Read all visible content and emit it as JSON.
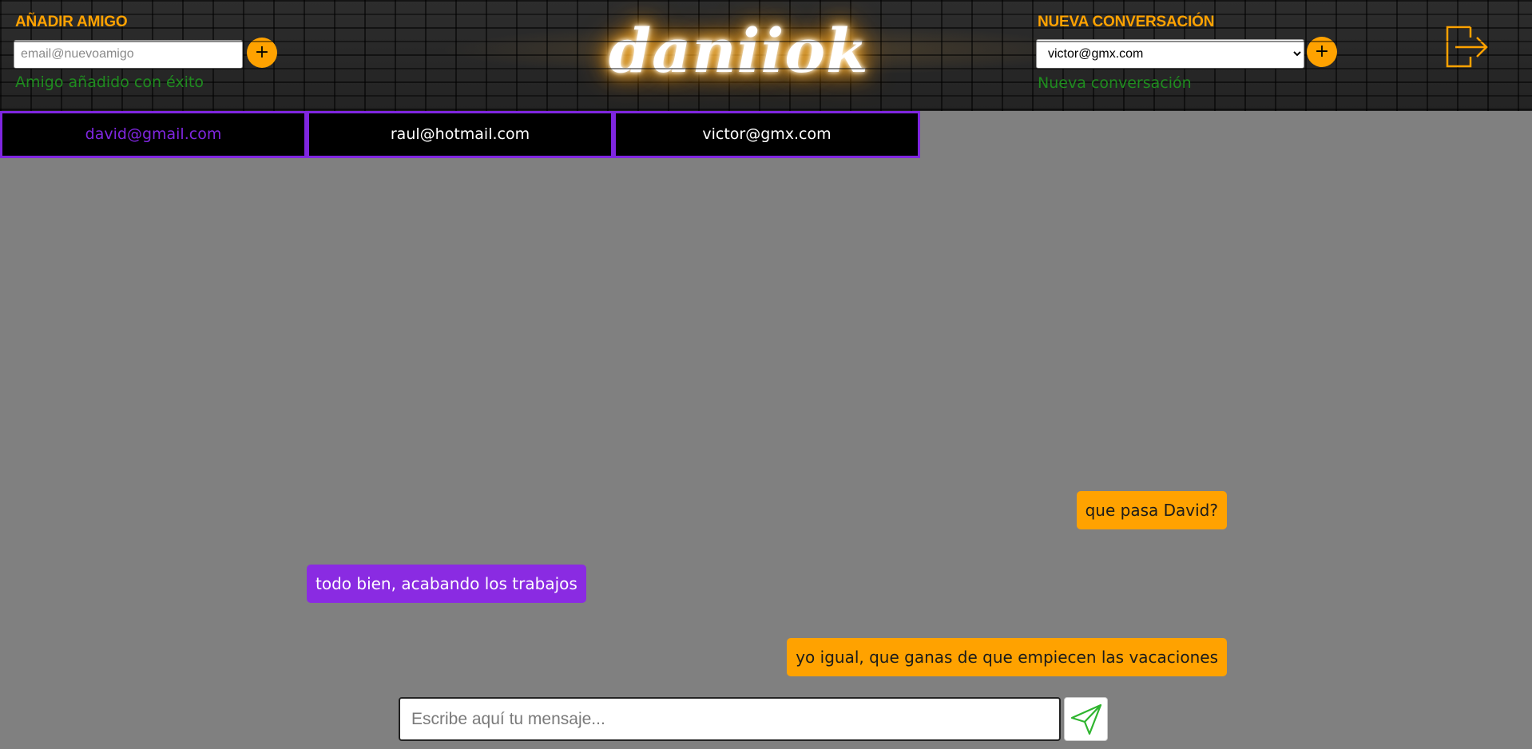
{
  "header": {
    "add_friend": {
      "title": "AÑADIR AMIGO",
      "placeholder": "email@nuevoamigo",
      "add_label": "+",
      "status": "Amigo añadido con éxito"
    },
    "logo": "daniiok",
    "new_conversation": {
      "title": "NUEVA CONVERSACIÓN",
      "selected": "victor@gmx.com",
      "add_label": "+",
      "status": "Nueva conversación"
    },
    "logout_icon": "logout-icon"
  },
  "tabs": [
    {
      "label": "david@gmail.com",
      "active": true
    },
    {
      "label": "raul@hotmail.com",
      "active": false
    },
    {
      "label": "victor@gmx.com",
      "active": false
    }
  ],
  "messages": [
    {
      "text": "que pasa David?",
      "direction": "sent"
    },
    {
      "text": "todo bien, acabando los trabajos",
      "direction": "received"
    },
    {
      "text": "yo igual, que ganas de que empiecen las vacaciones",
      "direction": "sent"
    }
  ],
  "composer": {
    "placeholder": "Escribe aquí tu mensaje...",
    "send_icon": "send-icon"
  },
  "colors": {
    "accent": "#ffa200",
    "purple": "#8a2be2",
    "success": "#1f8c1f",
    "background": "#808080"
  }
}
